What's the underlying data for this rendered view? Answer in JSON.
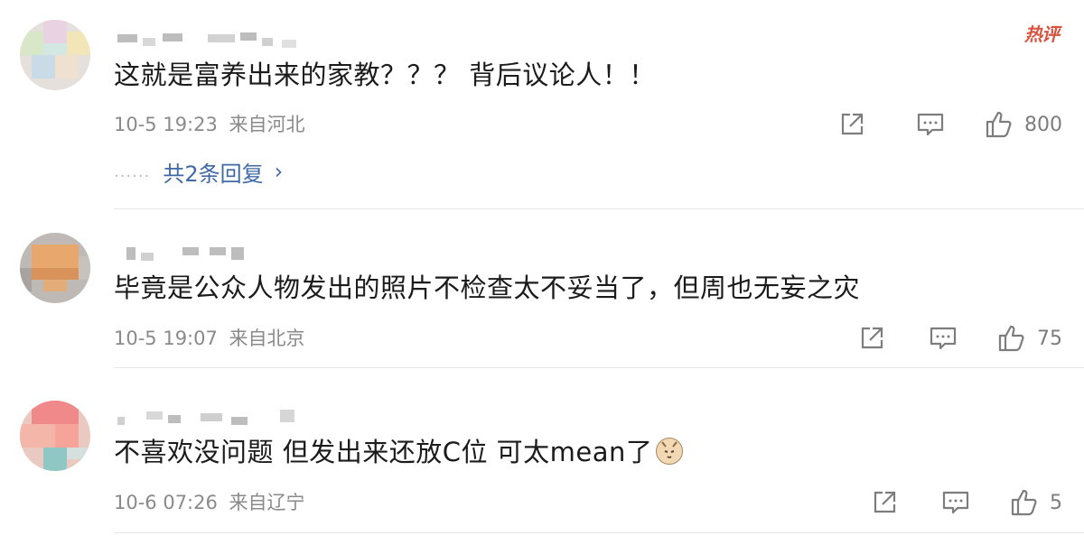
{
  "hot_label": "热评",
  "colors": {
    "hot": "#d9533f",
    "link": "#3f6aa5",
    "meta": "#8a8a8a"
  },
  "comments": [
    {
      "text": "这就是富养出来的家教？？？ 背后议论人！！",
      "time": "10-5 19:23",
      "location": "来自河北",
      "likes": "800",
      "replies_label": "共2条回复",
      "replies_dots": "......",
      "avatar_colors": [
        "#d9e7c9",
        "#e9d3e2",
        "#f2e6b8",
        "#c8dbe6",
        "#efe0cf",
        "#d3e8e2"
      ]
    },
    {
      "text": "毕竟是公众人物发出的照片不检查太不妥当了，但周也无妄之灾",
      "time": "10-5 19:07",
      "location": "来自北京",
      "likes": "75",
      "avatar_colors": [
        "#b9b3b0",
        "#e8a76c",
        "#d8925a",
        "#a9a39f",
        "#e3ad7a",
        "#c8c2bc"
      ]
    },
    {
      "text": "不喜欢没问题 但发出来还放C位 可太mean了",
      "time": "10-6 07:26",
      "location": "来自辽宁",
      "likes": "5",
      "avatar_colors": [
        "#f08a8a",
        "#f4b6a8",
        "#e9c9c0",
        "#8fc7c5",
        "#f6a39a",
        "#d4e0de"
      ]
    }
  ],
  "icons": {
    "share": "share-icon",
    "comment": "comment-icon",
    "like": "thumbs-up-icon"
  }
}
